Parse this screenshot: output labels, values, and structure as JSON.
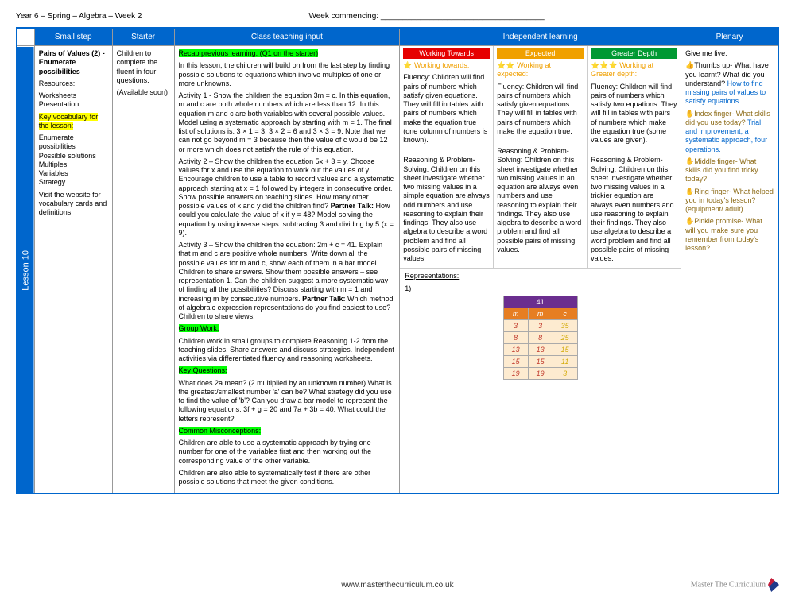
{
  "header": {
    "left": "Year 6 – Spring – Algebra – Week 2",
    "mid": "Week commencing: _____________________________________"
  },
  "cols": {
    "small": "Small step",
    "starter": "Starter",
    "teach": "Class teaching input",
    "indep": "Independent learning",
    "plenary": "Plenary"
  },
  "lesson_label": "Lesson 10",
  "small": {
    "title": "Pairs of Values (2) - Enumerate possibilities",
    "res_h": "Resources:",
    "res_list": "Worksheets\nPresentation",
    "vocab_h": "Key vocabulary for the lesson:",
    "vocab": "Enumerate possibilities\nPossible solutions\nMultiples\nVariables\nStrategy",
    "visit": "Visit the website for vocabulary cards and definitions."
  },
  "starter": {
    "p1": "Children to complete the fluent in four questions.",
    "p2": "(Available soon)"
  },
  "teach": {
    "recap_h": "Recap previous learning: (Q1 on the starter)",
    "intro": "In this lesson, the children will build on from the last step by finding possible solutions to equations which involve multiples of one or more unknowns.",
    "act1": "Activity 1 - Show the children the equation 3m = c. In this equation, m and c are both whole numbers which are less than 12. In this equation m and c are both variables with several possible values. Model using a systematic approach by starting with m = 1. The final list of solutions is: 3 × 1 = 3, 3 × 2 = 6 and 3 × 3 = 9. Note that we can not go beyond m = 3 because then the value of c would be 12 or more which does not satisfy the rule of this equation.",
    "act2a": "Activity 2 – Show the children the equation 5x + 3 = y. Choose values for x and use the equation to work out the values of y. Encourage children to use a table to record values and a systematic approach starting at x = 1 followed by integers in consecutive order. Show possible answers on teaching slides. How many other possible values of x and y did the children find? ",
    "pt1": "Partner Talk:",
    "act2b": " How could you calculate the value of x if y = 48? Model solving the equation by using inverse steps: subtracting 3 and dividing by 5 (x = 9).",
    "act3a": "Activity 3 – Show the children the equation: 2m + c = 41. Explain that m and c are positive whole numbers. Write down all the possible values for m and c, show each of them in a bar model. Children to share answers. Show them possible answers – see representation 1. Can the children suggest a more systematic way of finding all the possibilities? Discuss starting with m = 1 and increasing m by consecutive numbers. ",
    "pt2": "Partner Talk:",
    "act3b": " Which method of algebraic expression representations do you find easiest to use? Children to share views.",
    "gw_h": "Group Work:",
    "gw": "Children work in small groups to complete Reasoning 1-2 from the teaching slides. Share answers and discuss strategies. Independent activities via differentiated fluency and reasoning worksheets.",
    "kq_h": "Key Questions:",
    "kq": "What does 2a mean? (2 multiplied by an unknown number) What is the greatest/smallest number 'a' can be? What strategy did you use to find the value of 'b'? Can you draw a bar model to represent the following equations: 3f + g = 20 and 7a + 3b = 40. What could the letters represent?",
    "cm_h": "Common Misconceptions:",
    "cm1": "Children are able to use a systematic approach by trying one number for one of the variables first and then working out the corresponding value of the other variable.",
    "cm2": "Children are also able to systematically test if there are other possible solutions that meet the given conditions."
  },
  "indep": {
    "wt_h": "Working Towards",
    "ex_h": "Expected",
    "gd_h": "Greater Depth",
    "wt_s": "⭐ Working towards:",
    "wt_f": "Fluency: Children will find pairs of numbers which satisfy given equations. They will fill in tables with pairs of numbers which make the equation true (one column of numbers is known).",
    "wt_r": "Reasoning & Problem-Solving: Children on this sheet investigate whether two missing values in a simple equation are always odd numbers and use reasoning to explain their findings. They also use algebra to describe a word problem and find all possible pairs of missing values.",
    "ex_s": "⭐⭐ Working at expected:",
    "ex_f": "Fluency: Children will find pairs of numbers which satisfy given equations. They will fill in tables with pairs of numbers which make the equation true.",
    "ex_r": "Reasoning & Problem-Solving: Children on this sheet investigate whether two missing values in an equation are always even numbers and use reasoning to explain their findings. They also use algebra to describe a word problem and find all possible pairs of missing values.",
    "gd_s": "⭐⭐⭐ Working at Greater depth:",
    "gd_f": "Fluency: Children will find pairs of numbers which satisfy two equations. They will fill in tables with pairs of numbers which make the equation true (some values are given).",
    "gd_r": "Reasoning & Problem-Solving: Children on this sheet investigate whether two missing values in a trickier equation are always even numbers and use reasoning to explain their findings. They also use algebra to describe a word problem and find all possible pairs of missing values.",
    "rep_h": "Representations:",
    "rep_n": "1)"
  },
  "chart_data": {
    "type": "table",
    "title": "41",
    "columns": [
      "m",
      "m",
      "c"
    ],
    "rows": [
      [
        "3",
        "3",
        "35"
      ],
      [
        "8",
        "8",
        "25"
      ],
      [
        "13",
        "13",
        "15"
      ],
      [
        "15",
        "15",
        "11"
      ],
      [
        "19",
        "19",
        "3"
      ]
    ]
  },
  "plenary": {
    "intro": "Give me five:",
    "thumb_a": "👍Thumbs up- What have you learnt? What did you understand? ",
    "thumb_b": "How to find missing pairs of values to satisfy equations.",
    "index_a": "✋Index finger- What skills did you use today? ",
    "index_b": "Trial and improvement, a systematic approach, four operations.",
    "middle": "✋Middle finger- What skills did you find tricky today?",
    "ring": "✋Ring finger- What helped you in today's lesson? (equipment/ adult)",
    "pinkie": "✋Pinkie promise- What will you make sure you remember from today's lesson?"
  },
  "footer": "www.masterthecurriculum.co.uk",
  "logo": "Master The Curriculum"
}
